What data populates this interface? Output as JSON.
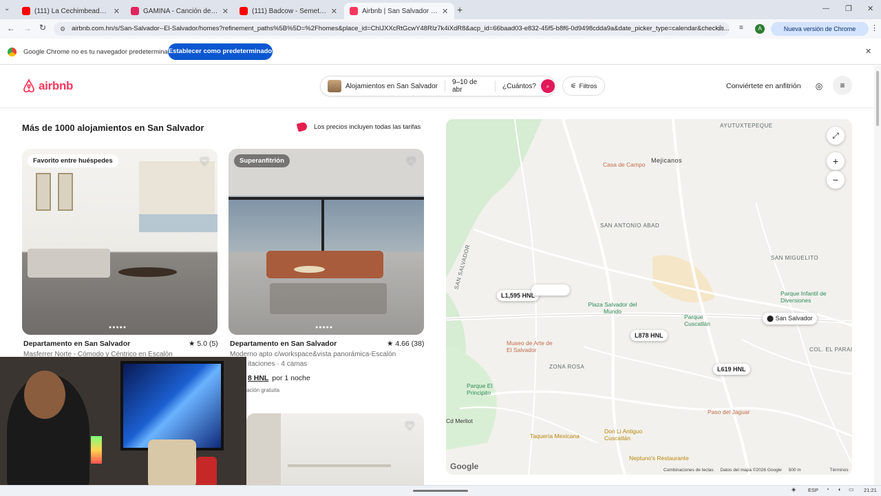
{
  "browser": {
    "tabs": [
      {
        "title": "(111) La Cechimbeada | HON V",
        "icon": "youtube-icon",
        "color": "#ff0000"
      },
      {
        "title": "GAMINA - Canción de Kris R. -",
        "icon": "music-icon",
        "color": "#e0245e"
      },
      {
        "title": "(111) Badcow - Semety (Video",
        "icon": "youtube-icon",
        "color": "#ff0000"
      },
      {
        "title": "Airbnb | San Salvador - Alojam",
        "icon": "airbnb-icon",
        "color": "#ff385c"
      }
    ],
    "url": "airbnb.com.hn/s/San-Salvador--El-Salvador/homes?refinement_paths%5B%5D=%2Fhomes&place_id=ChIJXXcRtGcwY48RIz7k4iXdR8&acp_id=66baad03-e832-45f5-b8f6-0d9498cdda9a&date_picker_type=calendar&checkin...",
    "update_label": "Nueva versión de Chrome disponible",
    "profile_initial": "A",
    "infobar_text": "Google Chrome no es tu navegador predeterminado",
    "infobar_button": "Establecer como predeterminado"
  },
  "header": {
    "logo": "airbnb",
    "search_location": "Alojamientos en San Salvador",
    "search_dates": "9–10 de abr",
    "search_guests": "¿Cuántos?",
    "filters": "Filtros",
    "host_link": "Conviértete en anfitrión"
  },
  "results": {
    "heading": "Más de 1000 alojamientos en San Salvador",
    "price_note": "Los precios incluyen todas las tarifas",
    "listings": [
      {
        "badge": "Favorito entre huéspedes",
        "title": "Departamento en San Salvador",
        "rating": "★ 5.0 (5)",
        "subtitle": "Masferrer Norte - Cómodo y Céntrico en Escalón"
      },
      {
        "badge": "Superanfitrión",
        "title": "Departamento en San Salvador",
        "rating": "★ 4.66 (38)",
        "subtitle": "Moderno apto c/workspace&vista panorámica-Escalón",
        "subtitle2": "itaciones · 4 camas",
        "price": "8 HNL",
        "price_suffix": "por 1 noche",
        "cancel": "ación gratuita"
      }
    ]
  },
  "map": {
    "area_labels": [
      "AYUTUXTEPEQUE",
      "Mejicanos",
      "SAN ANTONIO ABAD",
      "SAN MIGUELITO",
      "ZONA ROSA",
      "SAN SALVADOR",
      "COL. EL PARAISO"
    ],
    "pois": [
      "Casa de Campo",
      "Plaza Salvador del Mundo",
      "Parque Cuscatlán",
      "Parque Infantil de Diversiones",
      "Museo de Arte de El Salvador",
      "Parque El Principito",
      "Paso del Jaguar",
      "Taquería Mexicana",
      "Don Li Antiguo Cuscatlán",
      "Neptuno's Restaurante",
      "Cd Merliot"
    ],
    "prices": [
      "L1,595 HNL",
      "L878 HNL",
      "L619 HNL"
    ],
    "city_label": "San Salvador",
    "footer": [
      "Combinaciones de teclas",
      "Datos del mapa ©2026 Google",
      "500 m",
      "Términos"
    ],
    "google": "Google"
  },
  "system": {
    "lang": "ESP",
    "time": "21:21"
  }
}
